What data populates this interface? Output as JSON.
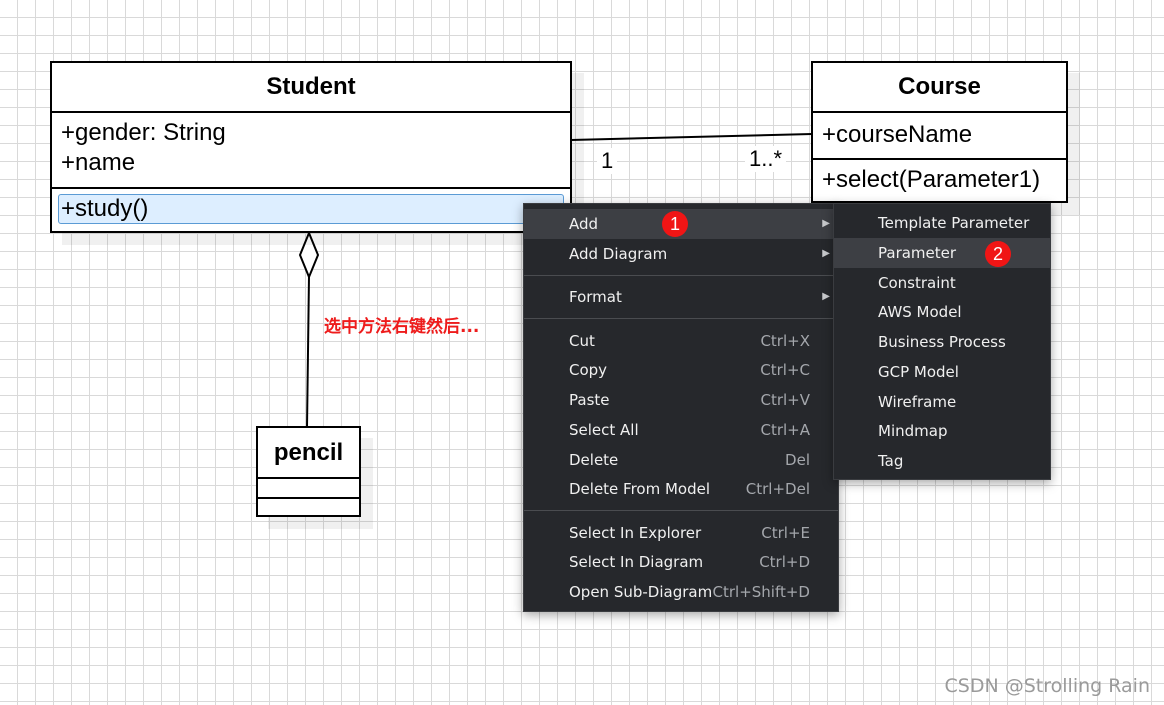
{
  "diagram": {
    "student": {
      "name": "Student",
      "attributes": [
        "+gender: String",
        "+name"
      ],
      "operation": "+study()"
    },
    "course": {
      "name": "Course",
      "attributes": [
        "+courseName"
      ],
      "operation": "+select(Parameter1)"
    },
    "pencil": {
      "name": "pencil"
    },
    "association": {
      "source_multiplicity": "1",
      "target_multiplicity": "1..*"
    },
    "annotation": "选中方法右键然后..."
  },
  "context_menu": {
    "items": [
      {
        "label": "Add",
        "submenu": true,
        "highlighted": true,
        "badge": "1"
      },
      {
        "label": "Add Diagram",
        "submenu": true
      },
      {
        "separator": true
      },
      {
        "label": "Format",
        "submenu": true
      },
      {
        "separator": true
      },
      {
        "label": "Cut",
        "shortcut": "Ctrl+X"
      },
      {
        "label": "Copy",
        "shortcut": "Ctrl+C"
      },
      {
        "label": "Paste",
        "shortcut": "Ctrl+V"
      },
      {
        "label": "Select All",
        "shortcut": "Ctrl+A"
      },
      {
        "label": "Delete",
        "shortcut": "Del"
      },
      {
        "label": "Delete From Model",
        "shortcut": "Ctrl+Del"
      },
      {
        "separator": true
      },
      {
        "label": "Select In Explorer",
        "shortcut": "Ctrl+E"
      },
      {
        "label": "Select In Diagram",
        "shortcut": "Ctrl+D"
      },
      {
        "label": "Open Sub-Diagram",
        "shortcut": "Ctrl+Shift+D"
      }
    ]
  },
  "submenu": {
    "items": [
      {
        "label": "Template Parameter"
      },
      {
        "label": "Parameter",
        "highlighted": true,
        "badge": "2"
      },
      {
        "label": "Constraint"
      },
      {
        "label": "AWS Model"
      },
      {
        "label": "Business Process"
      },
      {
        "label": "GCP Model"
      },
      {
        "label": "Wireframe"
      },
      {
        "label": "Mindmap"
      },
      {
        "label": "Tag"
      }
    ]
  },
  "colors": {
    "menu_bg": "#26282c",
    "menu_highlight": "#3d3f44",
    "badge": "#f01515",
    "annotation": "#ee1c1c",
    "selection": "#ddeeff"
  },
  "watermark": "CSDN @Strolling Rain"
}
